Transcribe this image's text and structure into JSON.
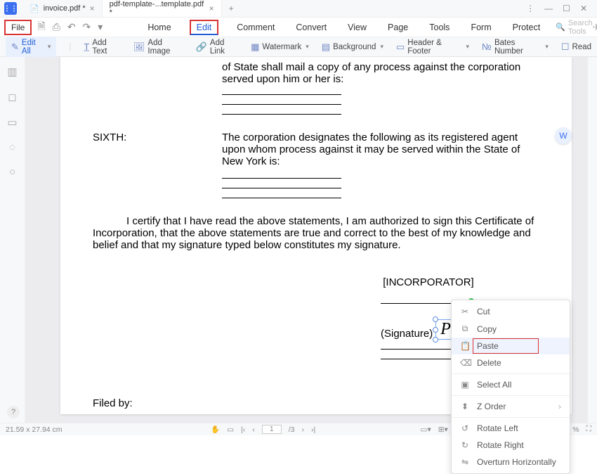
{
  "titlebar": {
    "tabs": [
      {
        "label": "invoice.pdf *"
      },
      {
        "label": "pdf-template-...template.pdf *"
      }
    ]
  },
  "menubar": {
    "file": "File",
    "items": [
      "Home",
      "Edit",
      "Comment",
      "Convert",
      "View",
      "Page",
      "Tools",
      "Form",
      "Protect"
    ],
    "search_placeholder": "Search Tools"
  },
  "ribbon": {
    "edit_all": "Edit All",
    "add_text": "Add Text",
    "add_image": "Add Image",
    "add_link": "Add Link",
    "watermark": "Watermark",
    "background": "Background",
    "header_footer": "Header & Footer",
    "bates": "Bates Number",
    "read": "Read"
  },
  "doc": {
    "cutline": "of State shall mail a copy of any process against the corporation served upon him or her is:",
    "sixth_label": "SIXTH:",
    "sixth_text": "The corporation designates the following as its registered agent upon whom process against it may be served within the State of New York is:",
    "cert_para": "I certify that I have read the above statements, I am authorized to sign this Certificate of Incorporation, that the above statements are true and correct to the best of my knowledge and belief and that my signature typed below constitutes my signature.",
    "incorporator": "[INCORPORATOR]",
    "signature_label": "(Signature)",
    "signature_value": "Peter Ga",
    "filed_by": "Filed by:"
  },
  "context": {
    "cut": "Cut",
    "copy": "Copy",
    "paste": "Paste",
    "delete": "Delete",
    "select_all": "Select All",
    "zorder": "Z Order",
    "rotate_left": "Rotate Left",
    "rotate_right": "Rotate Right",
    "overturn": "Overturn Horizontally"
  },
  "status": {
    "dims": "21.59 x 27.94 cm",
    "page_current": "1",
    "page_total": "/3",
    "zoom": "%"
  }
}
